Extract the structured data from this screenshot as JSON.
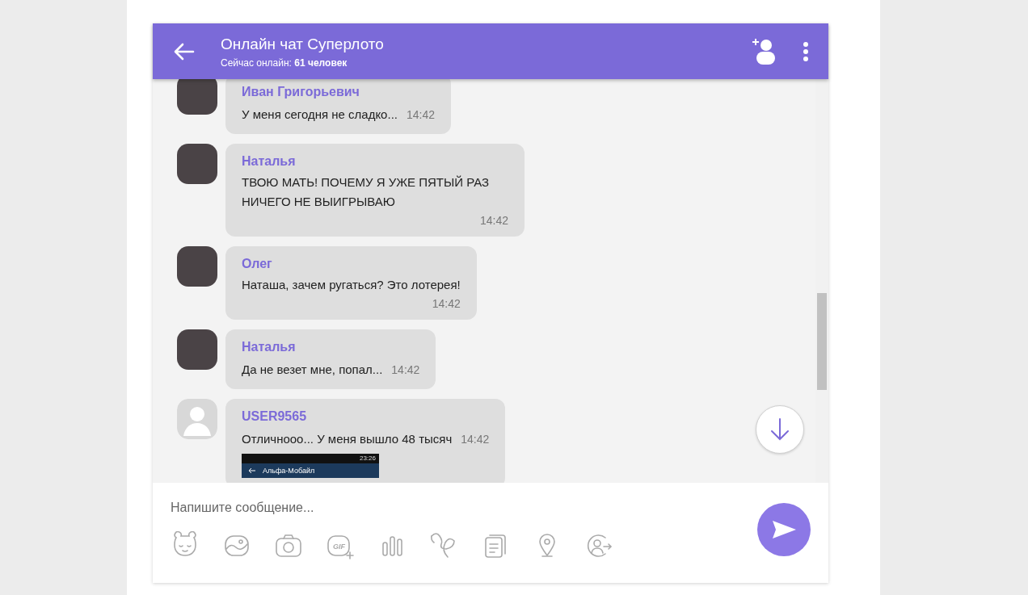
{
  "header": {
    "title": "Онлайн чат Суперлото",
    "online_label": "Сейчас онлайн:",
    "online_count": "61 человек"
  },
  "messages": [
    {
      "kind": "inline",
      "avatar": {
        "kind": "photo"
      },
      "author": "Иван Григорьевич",
      "text": "У меня сегодня не сладко...",
      "time": "14:42"
    },
    {
      "kind": "stacked",
      "avatar": {
        "kind": "photo"
      },
      "author": "Наталья",
      "text": "ТВОЮ МАТЬ! ПОЧЕМУ Я УЖЕ ПЯТЫЙ РАЗ НИЧЕГО НЕ ВЫИГРЫВАЮ",
      "time": "14:42"
    },
    {
      "kind": "stacked",
      "avatar": {
        "kind": "photo"
      },
      "author": "Олег",
      "text": "Наташа, зачем ругаться? Это лотерея!",
      "time": "14:42"
    },
    {
      "kind": "inline",
      "avatar": {
        "kind": "photo"
      },
      "author": "Наталья",
      "text": "Да не везет мне, попал...",
      "time": "14:42"
    },
    {
      "kind": "inline",
      "avatar": {
        "kind": "silhouette"
      },
      "author": "USER9565",
      "text": "Отличнооо... У меня вышло 48 тысяч",
      "time": "14:42",
      "attachment": {
        "status_time": "23:26",
        "title": "Альфа-Мобайл"
      }
    }
  ],
  "composer": {
    "placeholder": "Напишите сообщение...",
    "gif_label": "GIF"
  }
}
